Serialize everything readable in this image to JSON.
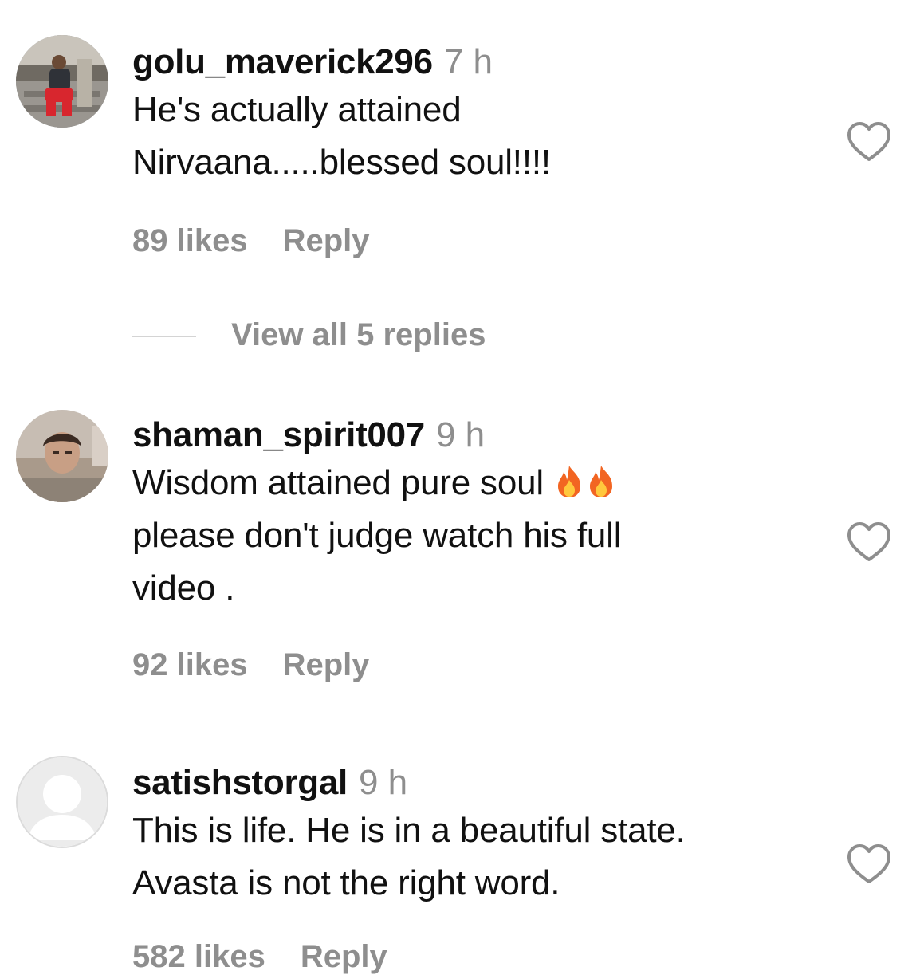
{
  "comments": [
    {
      "username": "golu_maverick296",
      "time": "7 h",
      "lines": [
        "He's actually attained",
        "Nirvaana.....blessed soul!!!!"
      ],
      "likes": "89 likes",
      "reply": "Reply",
      "view_replies": "View all 5 replies"
    },
    {
      "username": "shaman_spirit007",
      "time": "9 h",
      "lines": [
        "Wisdom attained pure soul",
        "please don't judge watch his full",
        "video ."
      ],
      "likes": "92 likes",
      "reply": "Reply"
    },
    {
      "username": "satishstorgal",
      "time": "9 h",
      "lines": [
        "This is life. He is in a beautiful state.",
        "Avasta is not the right word."
      ],
      "likes": "582 likes",
      "reply": "Reply"
    }
  ],
  "icons": {
    "like": "heart-outline-icon",
    "emoji": "fire-emoji-icon",
    "default_avatar": "default-avatar-icon"
  },
  "colors": {
    "text": "#111111",
    "muted": "#8e8e8e",
    "divider": "#d4d4d4",
    "default_avatar_bg": "#d9d9d9",
    "fire": "#f26522"
  }
}
